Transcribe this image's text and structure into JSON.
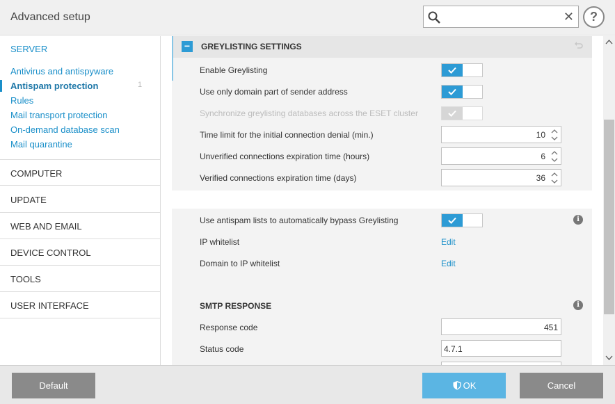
{
  "window": {
    "title": "Advanced setup"
  },
  "search": {
    "placeholder": "",
    "clear_glyph": "✕",
    "icon": "search-icon"
  },
  "help": {
    "label": "?"
  },
  "sidebar": {
    "server": "SERVER",
    "server_items": [
      {
        "label": "Antivirus and antispyware"
      },
      {
        "label": "Antispam protection",
        "active": true,
        "count": "1"
      },
      {
        "label": "Rules"
      },
      {
        "label": "Mail transport protection"
      },
      {
        "label": "On-demand database scan"
      },
      {
        "label": "Mail quarantine"
      }
    ],
    "sections": [
      "COMPUTER",
      "UPDATE",
      "WEB AND EMAIL",
      "DEVICE CONTROL",
      "TOOLS",
      "USER INTERFACE"
    ]
  },
  "greylisting": {
    "title": "GREYLISTING SETTINGS",
    "collapse_glyph": "−",
    "enable": {
      "label": "Enable Greylisting",
      "on": true
    },
    "domain_only": {
      "label": "Use only domain part of sender address",
      "on": true
    },
    "sync_cluster": {
      "label": "Synchronize greylisting databases across the ESET cluster",
      "on": true,
      "disabled": true
    },
    "time_limit": {
      "label": "Time limit for the initial connection denial (min.)",
      "value": "10"
    },
    "unverified": {
      "label": "Unverified connections expiration time (hours)",
      "value": "6"
    },
    "verified": {
      "label": "Verified connections expiration time (days)",
      "value": "36"
    },
    "bypass": {
      "label": "Use antispam lists to automatically bypass Greylisting",
      "on": true
    },
    "ip_whitelist": {
      "label": "IP whitelist",
      "action": "Edit"
    },
    "domain_ip_whitelist": {
      "label": "Domain to IP whitelist",
      "action": "Edit"
    }
  },
  "smtp": {
    "title": "SMTP RESPONSE",
    "response_code": {
      "label": "Response code",
      "value": "451"
    },
    "status_code": {
      "label": "Status code",
      "value": "4.7.1"
    }
  },
  "info_glyph": "i",
  "footer": {
    "default_label": "Default",
    "ok_label": "OK",
    "cancel_label": "Cancel"
  },
  "colors": {
    "accent": "#2d9bd5",
    "link": "#1a8fc9",
    "ok_button": "#5bb5e3",
    "gray_button": "#8a8a8a"
  }
}
